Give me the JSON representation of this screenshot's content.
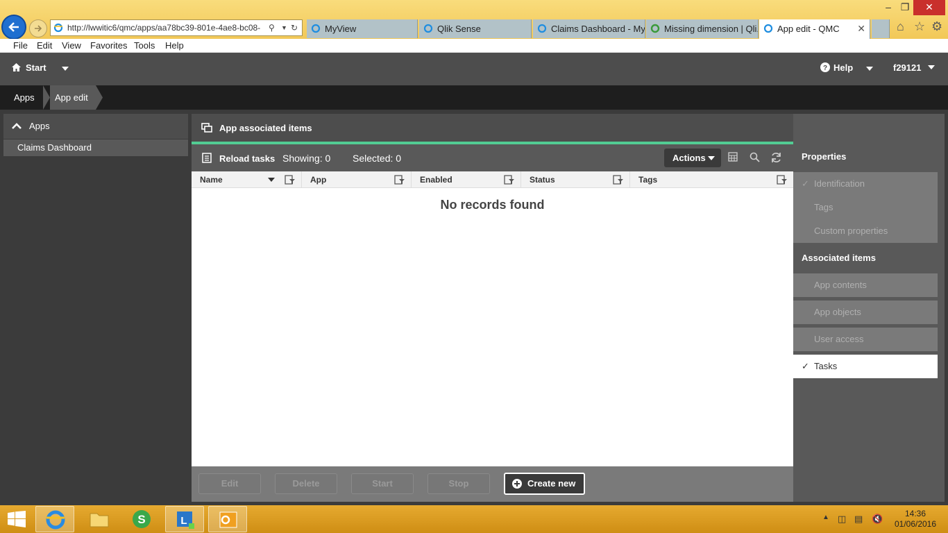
{
  "browser": {
    "url": "http://lwwitic6/qmc/apps/aa78bc39-801e-4ae8-bc08-",
    "tabs": [
      {
        "label": "MyView"
      },
      {
        "label": "Qlik Sense"
      },
      {
        "label": "Claims Dashboard - My..."
      },
      {
        "label": "Missing dimension | Qli..."
      },
      {
        "label": "App edit - QMC"
      }
    ],
    "tab_close": "✕",
    "menu": [
      "File",
      "Edit",
      "View",
      "Favorites",
      "Tools",
      "Help"
    ]
  },
  "header": {
    "start_label": "Start",
    "help_label": "Help",
    "user_label": "f29121"
  },
  "breadcrumb": [
    "Apps",
    "App edit"
  ],
  "left_panel": {
    "title": "Apps",
    "items": [
      "Claims Dashboard"
    ]
  },
  "main": {
    "title": "App associated items",
    "section_title": "Reload tasks",
    "showing": "Showing: 0",
    "selected": "Selected: 0",
    "actions_label": "Actions",
    "columns": [
      "Name",
      "App",
      "Enabled",
      "Status",
      "Tags"
    ],
    "empty_text": "No records found",
    "buttons": {
      "edit": "Edit",
      "delete": "Delete",
      "start": "Start",
      "stop": "Stop",
      "create_new": "Create new"
    }
  },
  "right_panel": {
    "properties_title": "Properties",
    "properties": [
      "Identification",
      "Tags",
      "Custom properties"
    ],
    "associated_title": "Associated items",
    "associated": [
      "App contents",
      "App objects",
      "User access",
      "Tasks"
    ]
  },
  "taskbar": {
    "time": "14:36",
    "date": "01/06/2016"
  },
  "colors": {
    "accent": "#52cc93",
    "header": "#4d4d4d",
    "breadcrumb": "#1e1e1e",
    "panel": "#595959"
  }
}
